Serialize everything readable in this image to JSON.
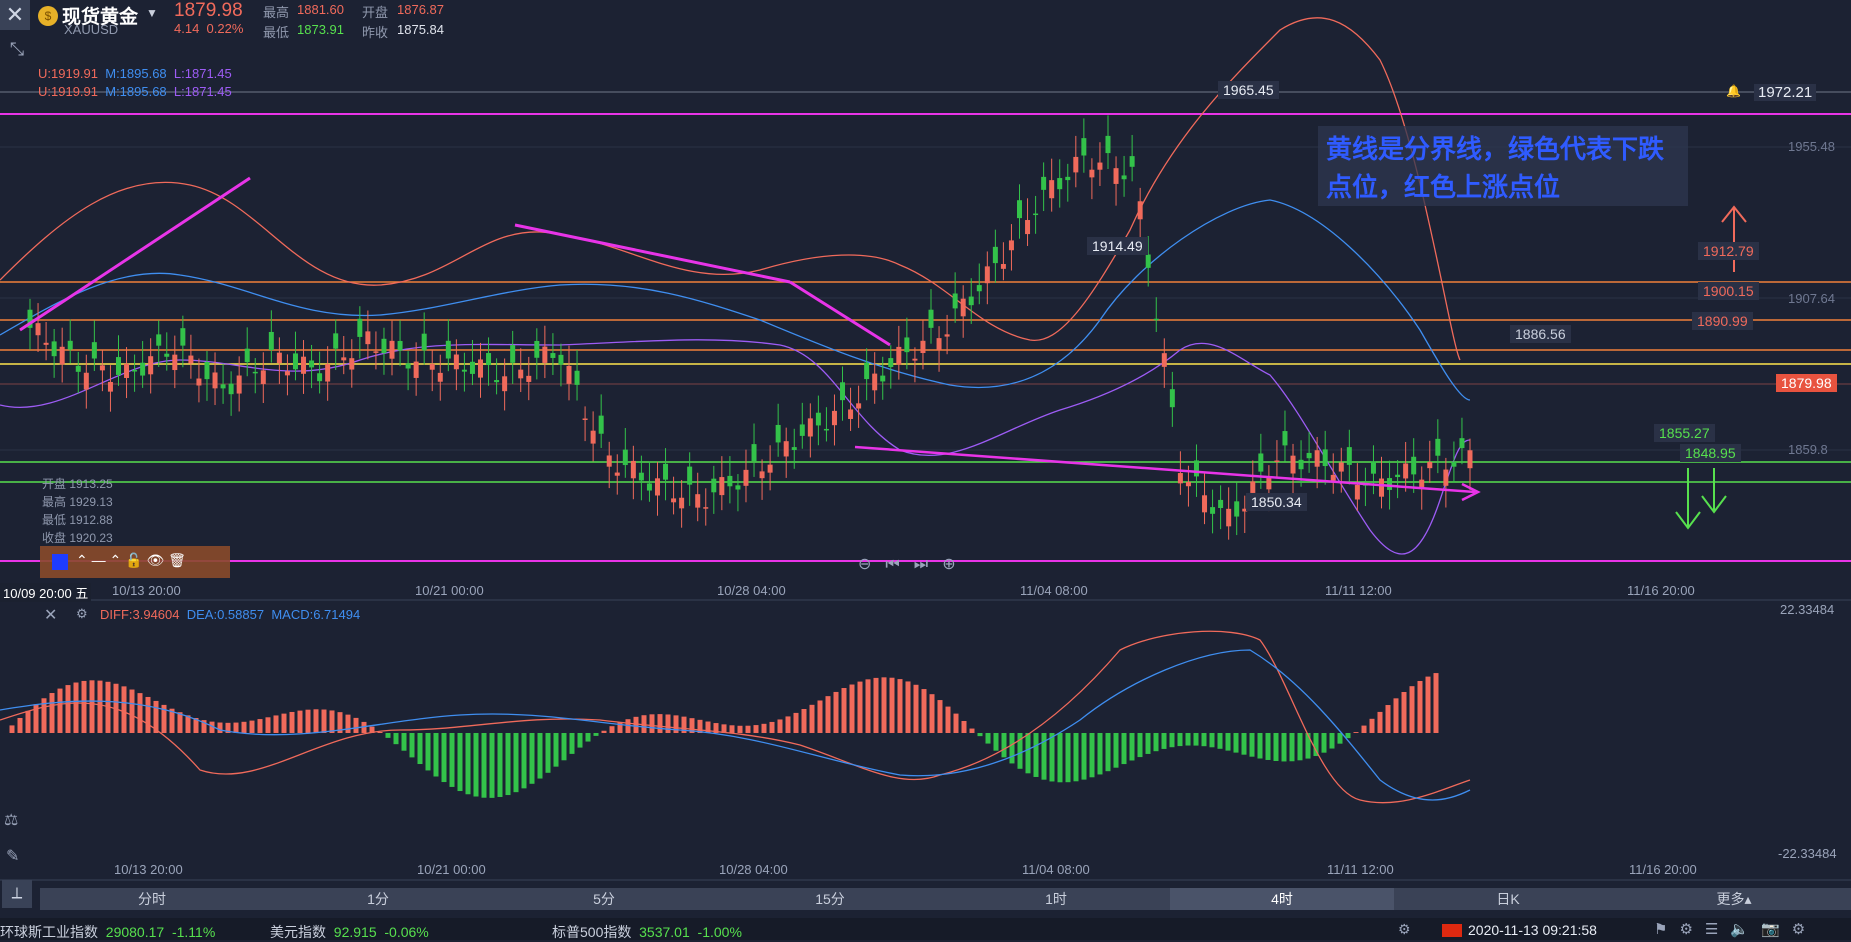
{
  "header": {
    "close": "✕",
    "title": "现货黄金",
    "symbol": "XAUUSD",
    "price": "1879.98",
    "change": "4.14",
    "change_pct": "0.22%",
    "high_label": "最高",
    "high": "1881.60",
    "open_label": "开盘",
    "open": "1876.87",
    "low_label": "最低",
    "low": "1873.91",
    "prev_label": "昨收",
    "prev": "1875.84"
  },
  "boll1": {
    "u": "U:1919.91",
    "m": "M:1895.68",
    "l": "L:1871.45"
  },
  "boll2": {
    "u": "U:1919.91",
    "m": "M:1895.68",
    "l": "L:1871.45"
  },
  "ohlc_panel": {
    "open": "开盘 1913.25",
    "high": "最高 1929.13",
    "low": "最低 1912.88",
    "close": "收盘 1920.23"
  },
  "annotation": "黄线是分界线，绿色代表下跌点位，红色上涨点位",
  "macd_header": {
    "diff": "DIFF:3.94604",
    "dea": "DEA:0.58857",
    "macd": "MACD:6.71494"
  },
  "cursor_time": "10/09 20:00 五",
  "x_labels": [
    "10/13 20:00",
    "10/21 00:00",
    "10/28 04:00",
    "11/04 08:00",
    "11/11 12:00",
    "11/16 20:00"
  ],
  "y_labels": [
    "1972.21",
    "1955.48",
    "1907.64",
    "1859.8"
  ],
  "macd_y": [
    "22.33484",
    "-22.33484"
  ],
  "levels": {
    "magenta_top": "1965.45",
    "r1": "1912.79",
    "r2": "1900.15",
    "r3": "1890.99",
    "mid": "1886.56",
    "s1": "1855.27",
    "s2": "1848.95",
    "last": "1879.98",
    "p1914": "1914.49",
    "p1850": "1850.34"
  },
  "tabs": [
    "分时",
    "1分",
    "5分",
    "15分",
    "1时",
    "4时",
    "日K",
    "更多▴"
  ],
  "tickers": [
    {
      "name": "环球斯工业指数",
      "value": "29080.17",
      "chg": "-1.11%"
    },
    {
      "name": "美元指数",
      "value": "92.915",
      "chg": "-0.06%"
    },
    {
      "name": "标普500指数",
      "value": "3537.01",
      "chg": "-1.00%"
    }
  ],
  "datetime": "2020-11-13 09:21:58",
  "colors": {
    "up": "#f06a5b",
    "down": "#33c24a",
    "magenta": "#e834e8",
    "orange": "#f07f3a",
    "yellow": "#ffe44d",
    "green": "#57e04e"
  },
  "chart_data": {
    "type": "candlestick",
    "instrument": "XAUUSD",
    "ylim": [
      1840,
      1980
    ],
    "x": [
      "10/13 20:00",
      "10/21 00:00",
      "10/28 04:00",
      "11/04 08:00",
      "11/11 12:00",
      "11/16 20:00"
    ],
    "close_series": [
      1915,
      1905,
      1902,
      1910,
      1898,
      1907,
      1903,
      1912,
      1906,
      1905,
      1902,
      1909,
      1880,
      1872,
      1868,
      1875,
      1885,
      1893,
      1906,
      1914,
      1930,
      1950,
      1962,
      1958,
      1875,
      1862,
      1880,
      1878,
      1872,
      1876,
      1880
    ],
    "horizontal_levels": [
      1965.45,
      1912.79,
      1900.15,
      1890.99,
      1886.56,
      1855.27,
      1848.95
    ]
  }
}
